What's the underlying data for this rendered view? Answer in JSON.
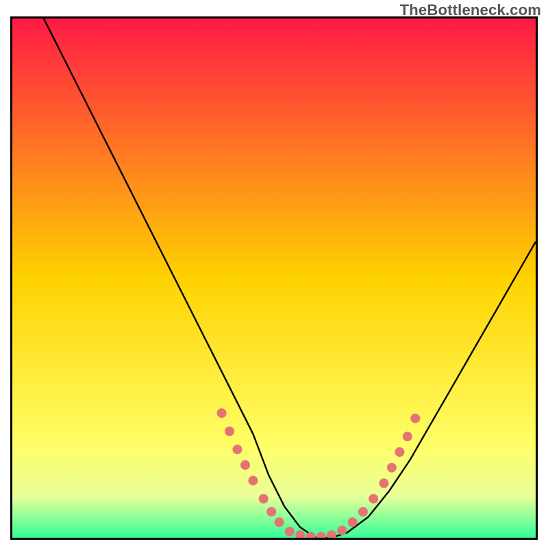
{
  "watermark": "TheBottleneck.com",
  "chart_data": {
    "type": "line",
    "title": "",
    "xlabel": "",
    "ylabel": "",
    "xlim": [
      0,
      100
    ],
    "ylim": [
      0,
      100
    ],
    "background_gradient": {
      "stops": [
        {
          "offset": 0.0,
          "color": "#ff1a46"
        },
        {
          "offset": 0.5,
          "color": "#ffd200"
        },
        {
          "offset": 0.82,
          "color": "#ffff66"
        },
        {
          "offset": 0.92,
          "color": "#eaff99"
        },
        {
          "offset": 1.0,
          "color": "#33ff99"
        }
      ]
    },
    "series": [
      {
        "name": "curve",
        "color": "#000000",
        "x": [
          6,
          10,
          14,
          18,
          22,
          26,
          30,
          34,
          38,
          42,
          46,
          49,
          52,
          55,
          58,
          61,
          64,
          68,
          72,
          76,
          80,
          84,
          88,
          92,
          96,
          100
        ],
        "y": [
          100,
          92,
          84,
          76,
          68,
          60,
          52,
          44,
          36,
          28,
          20,
          12,
          6,
          2,
          0,
          0,
          1,
          4,
          9,
          15,
          22,
          29,
          36,
          43,
          50,
          57
        ]
      }
    ],
    "scatter": {
      "name": "markers",
      "color": "#e57373",
      "radius": 7,
      "points": [
        {
          "x": 40,
          "y": 24
        },
        {
          "x": 41.5,
          "y": 20.5
        },
        {
          "x": 43,
          "y": 17
        },
        {
          "x": 44.5,
          "y": 14
        },
        {
          "x": 46,
          "y": 11
        },
        {
          "x": 48,
          "y": 7.5
        },
        {
          "x": 49.5,
          "y": 5
        },
        {
          "x": 51,
          "y": 3
        },
        {
          "x": 53,
          "y": 1.2
        },
        {
          "x": 55,
          "y": 0.5
        },
        {
          "x": 57,
          "y": 0.2
        },
        {
          "x": 59,
          "y": 0.2
        },
        {
          "x": 61,
          "y": 0.5
        },
        {
          "x": 63,
          "y": 1.4
        },
        {
          "x": 65,
          "y": 3
        },
        {
          "x": 67,
          "y": 5
        },
        {
          "x": 69,
          "y": 7.5
        },
        {
          "x": 71,
          "y": 10.5
        },
        {
          "x": 72.5,
          "y": 13.5
        },
        {
          "x": 74,
          "y": 16.5
        },
        {
          "x": 75.5,
          "y": 19.5
        },
        {
          "x": 77,
          "y": 23
        }
      ]
    }
  }
}
